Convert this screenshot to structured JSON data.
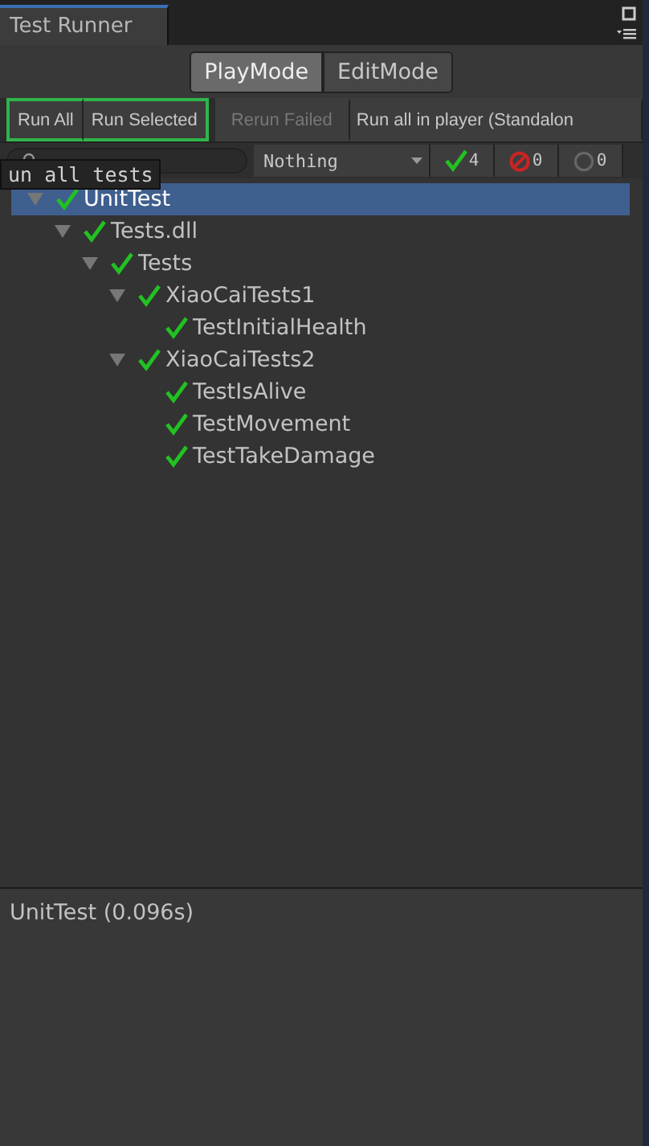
{
  "window": {
    "title": "Test Runner"
  },
  "mode_tabs": [
    {
      "label": "PlayMode",
      "selected": true
    },
    {
      "label": "EditMode",
      "selected": false
    }
  ],
  "toolbar": {
    "buttons": [
      {
        "label": "Run All",
        "disabled": false,
        "highlighted": true
      },
      {
        "label": "Run Selected",
        "disabled": false,
        "highlighted": true
      },
      {
        "label": "Rerun Failed",
        "disabled": true,
        "highlighted": false
      },
      {
        "label": "Run all in player (Standalon",
        "disabled": false,
        "highlighted": false
      }
    ]
  },
  "filter": {
    "category": "Nothing",
    "counters": [
      {
        "kind": "passed",
        "count": "4"
      },
      {
        "kind": "failed",
        "count": "0"
      },
      {
        "kind": "skipped",
        "count": "0"
      }
    ]
  },
  "tooltip": "un all tests",
  "tree": [
    {
      "name": "UnitTest",
      "passed": true,
      "selected": true,
      "expanded": true,
      "children": [
        {
          "name": "Tests.dll",
          "passed": true,
          "selected": false,
          "expanded": true,
          "children": [
            {
              "name": "Tests",
              "passed": true,
              "selected": false,
              "expanded": true,
              "children": [
                {
                  "name": "XiaoCaiTests1",
                  "passed": true,
                  "selected": false,
                  "expanded": true,
                  "children": [
                    {
                      "name": "TestInitialHealth",
                      "passed": true,
                      "selected": false
                    }
                  ]
                },
                {
                  "name": "XiaoCaiTests2",
                  "passed": true,
                  "selected": false,
                  "expanded": true,
                  "children": [
                    {
                      "name": "TestIsAlive",
                      "passed": true,
                      "selected": false
                    },
                    {
                      "name": "TestMovement",
                      "passed": true,
                      "selected": false
                    },
                    {
                      "name": "TestTakeDamage",
                      "passed": true,
                      "selected": false
                    }
                  ]
                }
              ]
            }
          ]
        }
      ]
    }
  ],
  "details": "UnitTest (0.096s)"
}
